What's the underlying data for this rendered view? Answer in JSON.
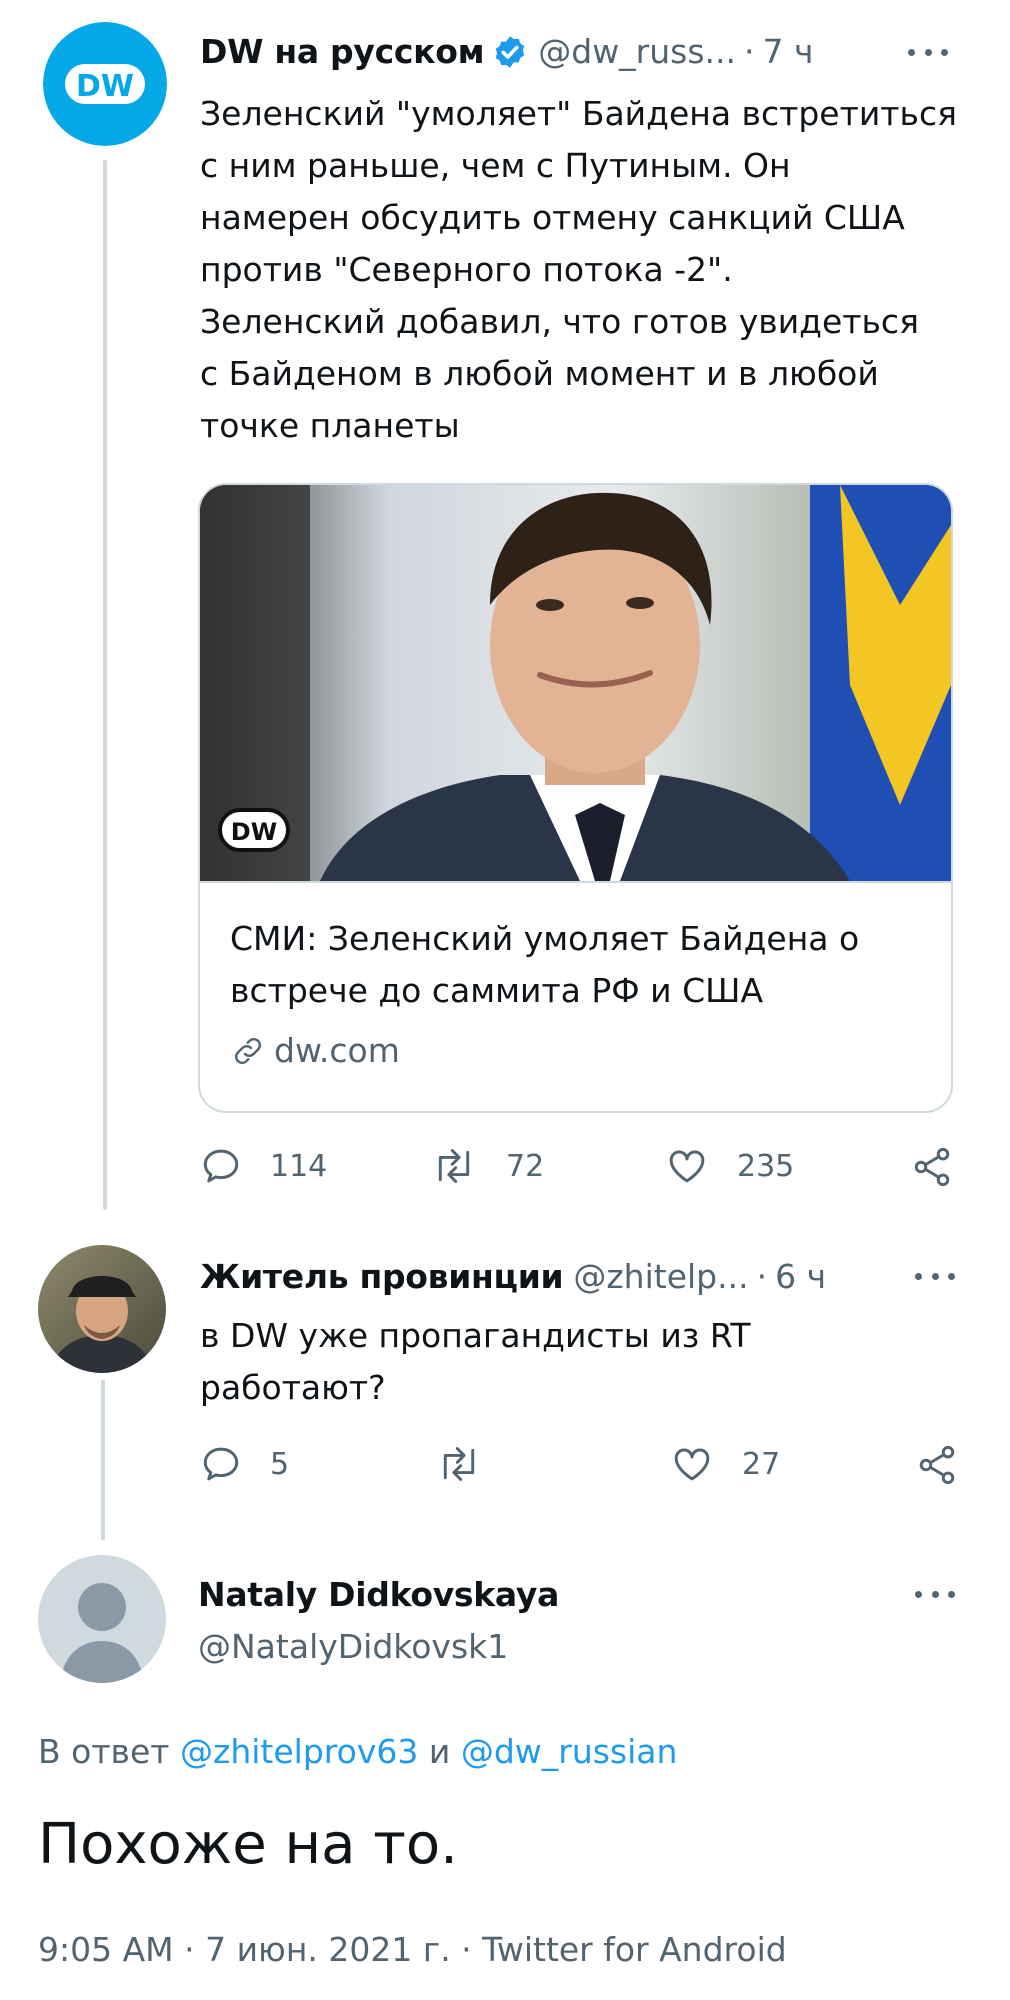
{
  "tweets": [
    {
      "name": "DW на русском",
      "verified": true,
      "handle": "@dw_russ...",
      "time": "7 ч",
      "text_lines": [
        "Зеленский \"умоляет\" Байдена встретиться",
        "с ним раньше, чем с Путиным. Он",
        "намерен обсудить отмену санкций США",
        "против \"Северного потока -2\".",
        "Зеленский добавил, что готов увидеться",
        "с Байденом в любой момент и в любой",
        "точке планеты"
      ],
      "card": {
        "image_logo": "DW",
        "title_lines": [
          "СМИ: Зеленский умоляет Байдена о",
          "встрече до саммита РФ и США"
        ],
        "domain": "dw.com"
      },
      "stats": {
        "replies": "114",
        "retweets": "72",
        "likes": "235"
      }
    },
    {
      "name": "Житель провинции",
      "handle": "@zhitelp...",
      "time": "6 ч",
      "text_lines": [
        "в DW уже пропагандисты из RT",
        "работают?"
      ],
      "stats": {
        "replies": "5",
        "retweets": "",
        "likes": "27"
      }
    }
  ],
  "focused": {
    "name": "Nataly Didkovskaya",
    "handle": "@NatalyDidkovsk1",
    "reply_prefix": "В ответ",
    "mention1": "@zhitelprov63",
    "reply_and": "и",
    "mention2": "@dw_russian",
    "text": "Похоже на то.",
    "meta": "9:05 AM · 7 июн. 2021 г. · Twitter for Android"
  },
  "colors": {
    "accent": "#1d9bf0",
    "text": "#0f1419",
    "secondary": "#536471",
    "border": "#cfd9de",
    "dw_blue": "#05a8e6"
  },
  "icons": [
    "reply-icon",
    "retweet-icon",
    "like-icon",
    "share-icon",
    "more-icon",
    "verified-icon",
    "link-icon"
  ]
}
